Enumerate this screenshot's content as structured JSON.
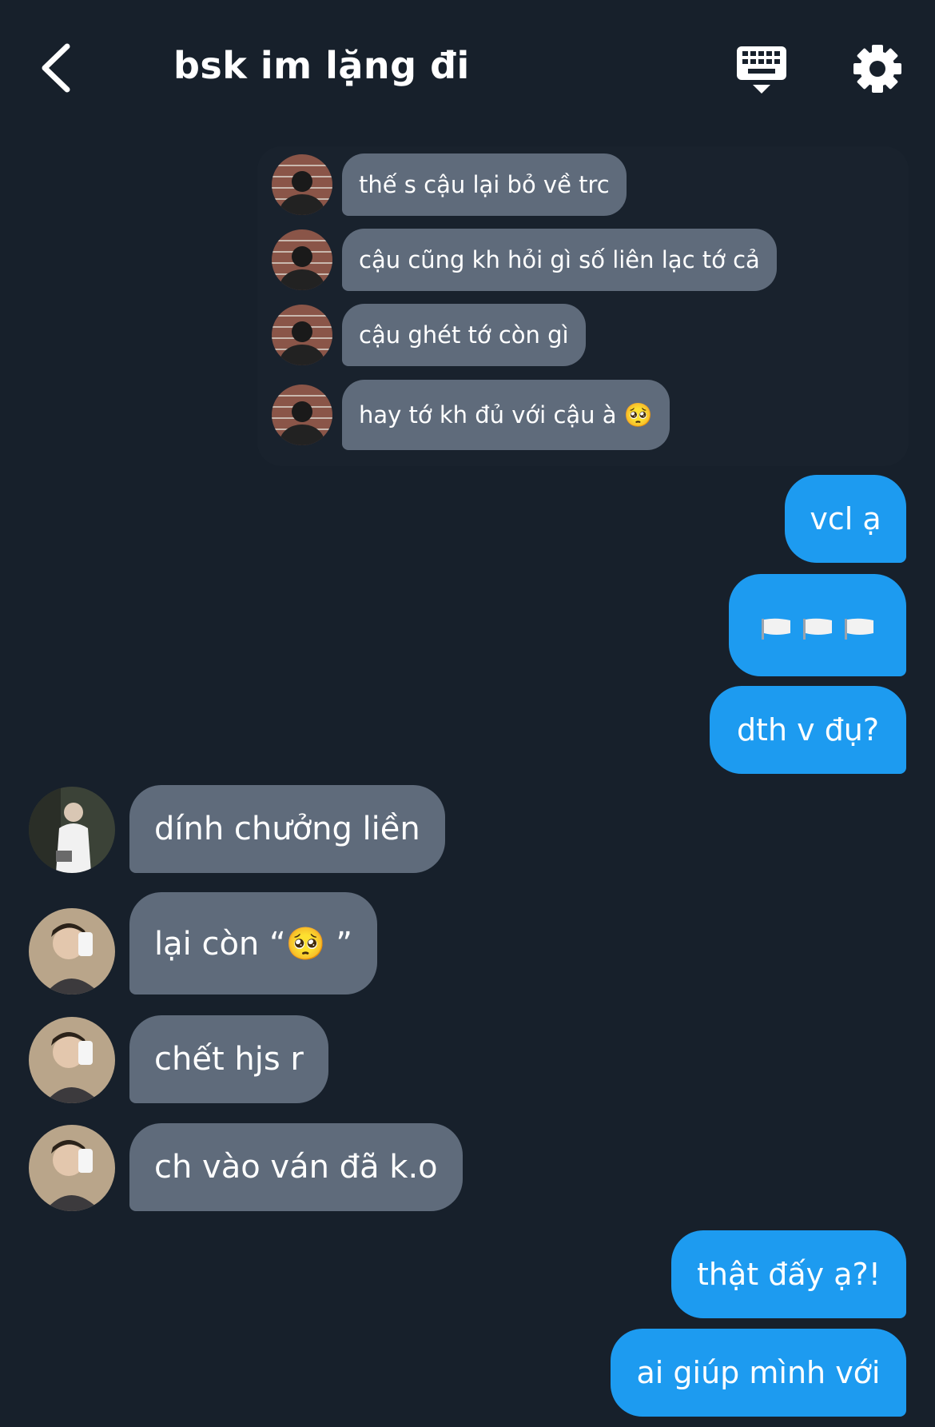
{
  "header": {
    "title": "bsk im lặng đi",
    "back_icon": "chevron-left-icon",
    "keyboard_icon": "keyboard-hide-icon",
    "settings_icon": "gear-icon"
  },
  "quoted": [
    {
      "text": "thế s cậu lại bỏ về trc"
    },
    {
      "text": "cậu cũng kh hỏi gì số liên lạc tớ cả"
    },
    {
      "text": "cậu ghét tớ còn gì"
    },
    {
      "text": "hay tớ kh đủ với cậu à 🥺"
    }
  ],
  "messages": {
    "out1": "vcl ạ",
    "out2_icon": "white-flag-icon",
    "out3": "dth v đụ?",
    "in1": "dính chưởng liền",
    "in2": "lại còn “🥺 ”",
    "in3": "chết hjs r",
    "in4": "ch vào ván đã k.o",
    "out4": "thật đấy ạ?!",
    "out5": "ai giúp mình với"
  },
  "colors": {
    "background": "#17202b",
    "outgoing_bubble": "#1d9bf0",
    "incoming_bubble": "#5f6b7b"
  }
}
